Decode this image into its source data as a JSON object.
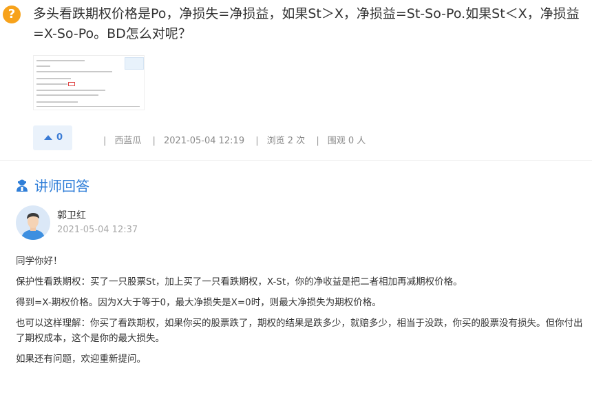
{
  "question": {
    "icon": "question-icon",
    "title": "多头看跌期权价格是Po，净损失=净损益，如果St＞X，净损益=St-So-Po.如果St＜X，净损益=X-So-Po。BD怎么对呢？",
    "likes": "0",
    "author": "西蓝瓜",
    "datetime": "2021-05-04 12:19",
    "views": "浏览 2 次",
    "watchers": "围观 0 人"
  },
  "answer_section": {
    "heading": "讲师回答",
    "heading_icon": "teacher-icon",
    "teacher_name": "郭卫红",
    "teacher_datetime": "2021-05-04 12:37",
    "paragraphs": [
      "同学你好！",
      "保护性看跌期权：买了一只股票St，加上买了一只看跌期权，X-St，你的净收益是把二者相加再减期权价格。",
      "得到=X-期权价格。因为X大于等于0，最大净损失是X=0时，则最大净损失为期权价格。",
      "也可以这样理解：你买了看跌期权，如果你买的股票跌了，期权的结果是跌多少，就赔多少，相当于没跌，你买的股票没有损失。但你付出了期权成本，这个是你的最大损失。",
      "如果还有问题，欢迎重新提问。"
    ]
  },
  "colors": {
    "accent": "#2f7ed8",
    "question_icon": "#f7a21b",
    "like_bg": "#eaf2fb"
  }
}
